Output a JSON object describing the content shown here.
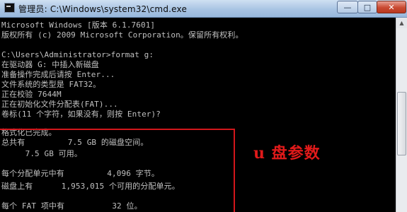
{
  "window": {
    "title": "管理员: C:\\Windows\\system32\\cmd.exe",
    "controls": {
      "minimize": "—",
      "maximize": "□",
      "close": "✕"
    }
  },
  "console": {
    "lines": [
      "Microsoft Windows [版本 6.1.7601]",
      "版权所有 (c) 2009 Microsoft Corporation。保留所有权利。",
      "",
      "C:\\Users\\Administrator>format g:",
      "在驱动器 G: 中插入新磁盘",
      "准备操作完成后请按 Enter...",
      "文件系统的类型是 FAT32。",
      "正在校验 7644M",
      "正在初始化文件分配表(FAT)...",
      "卷标(11 个字符，如果没有，则按 Enter)?",
      "格式化已完成。",
      "总共有         7.5 GB 的磁盘空间。",
      "     7.5 GB 可用。",
      "",
      "每个分配单元中有         4,096 字节。",
      "磁盘上有      1,953,015 个可用的分配单元。",
      "",
      "每个 FAT 项中有          32 位。"
    ]
  },
  "annotation": {
    "text": "u 盘参数"
  },
  "colors": {
    "console_text": "#c0c0c0",
    "annotation": "#e01a1a",
    "highlight_border": "#d2161b"
  }
}
